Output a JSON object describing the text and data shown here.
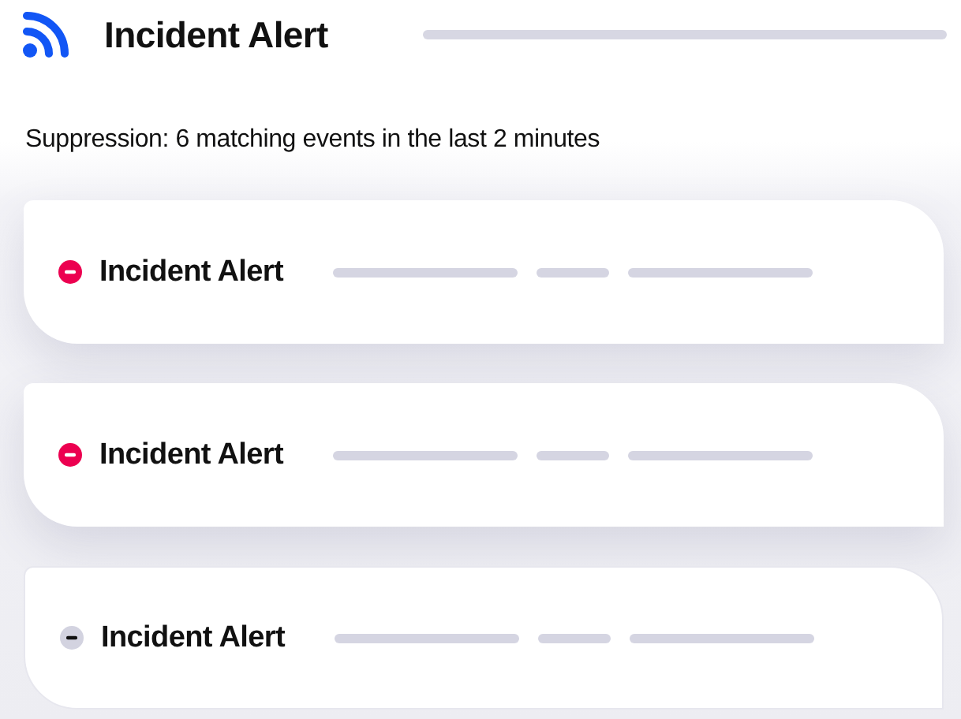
{
  "header": {
    "title": "Incident Alert"
  },
  "suppression_note": "Suppression: 6 matching events in the last 2 minutes",
  "alerts": [
    {
      "title": "Incident Alert",
      "muted": false
    },
    {
      "title": "Incident Alert",
      "muted": false
    },
    {
      "title": "Incident Alert",
      "muted": true
    }
  ]
}
